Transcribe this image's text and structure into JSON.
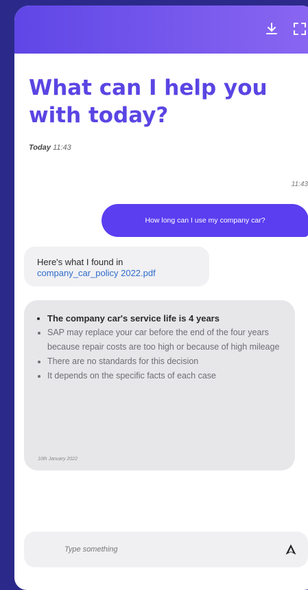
{
  "header": {
    "download_icon": "download-icon",
    "expand_icon": "fullscreen-icon"
  },
  "chat": {
    "title": "What can I help you with today?",
    "today_label": "Today",
    "today_time": "11:43",
    "messages": [
      {
        "role": "user",
        "time": "11:43",
        "text": "How long can I use my company car?"
      },
      {
        "role": "bot",
        "intro": "Here's what I found in",
        "link": "company_car_policy 2022.pdf"
      },
      {
        "role": "bot",
        "bullets": [
          "The company car's service life is 4 years",
          "SAP may replace your car before the end of the four years because repair costs are too high or because of high mileage",
          "There are no standards for this decision",
          "It depends on the specific facts of each case"
        ],
        "date": "10th January 2022"
      }
    ]
  },
  "composer": {
    "placeholder": "Type something",
    "send_icon": "send-icon"
  },
  "colors": {
    "accent": "#5a45e3",
    "user_bubble": "#5b3ef0",
    "link": "#2f6cc9",
    "background": "#2b2a8a"
  }
}
